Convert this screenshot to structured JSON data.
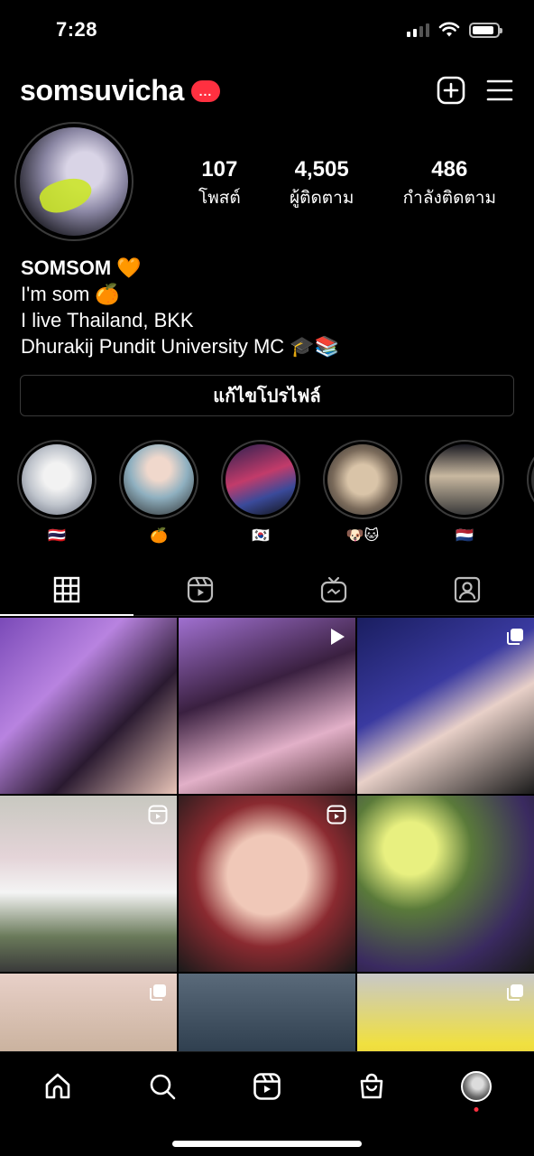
{
  "status_bar": {
    "time": "7:28",
    "battery_level": 0.9
  },
  "header": {
    "username": "somsuvicha",
    "badge_text": "...",
    "icons": [
      "new-post-icon",
      "menu-icon"
    ]
  },
  "profile": {
    "stats": [
      {
        "value": "107",
        "label": "โพสต์"
      },
      {
        "value": "4,505",
        "label": "ผู้ติดตาม"
      },
      {
        "value": "486",
        "label": "กำลังติดตาม"
      }
    ],
    "bio": {
      "name": "SOMSOM 🧡",
      "lines": [
        "I'm som 🍊",
        "I live Thailand, BKK",
        "Dhurakij Pundit University MC 🎓📚"
      ]
    },
    "edit_button_label": "แก้ไขโปรไฟล์"
  },
  "highlights": [
    {
      "label": "🇹🇭"
    },
    {
      "label": "🍊"
    },
    {
      "label": "🇰🇷"
    },
    {
      "label": "🐶🐱"
    },
    {
      "label": "🇳🇱"
    }
  ],
  "tabs": [
    {
      "icon": "grid-icon",
      "active": true
    },
    {
      "icon": "reels-icon",
      "active": false
    },
    {
      "icon": "igtv-icon",
      "active": false
    },
    {
      "icon": "tagged-icon",
      "active": false
    }
  ],
  "grid_posts": [
    {
      "type": "photo"
    },
    {
      "type": "video"
    },
    {
      "type": "carousel"
    },
    {
      "type": "reel"
    },
    {
      "type": "reel"
    },
    {
      "type": "photo"
    },
    {
      "type": "carousel"
    },
    {
      "type": "photo"
    },
    {
      "type": "carousel"
    }
  ],
  "bottom_nav": [
    "home-icon",
    "search-icon",
    "reels-icon",
    "shop-icon",
    "profile-avatar"
  ],
  "colors": {
    "background": "#000000",
    "badge": "#ff3040",
    "border": "#3a3a3a"
  }
}
